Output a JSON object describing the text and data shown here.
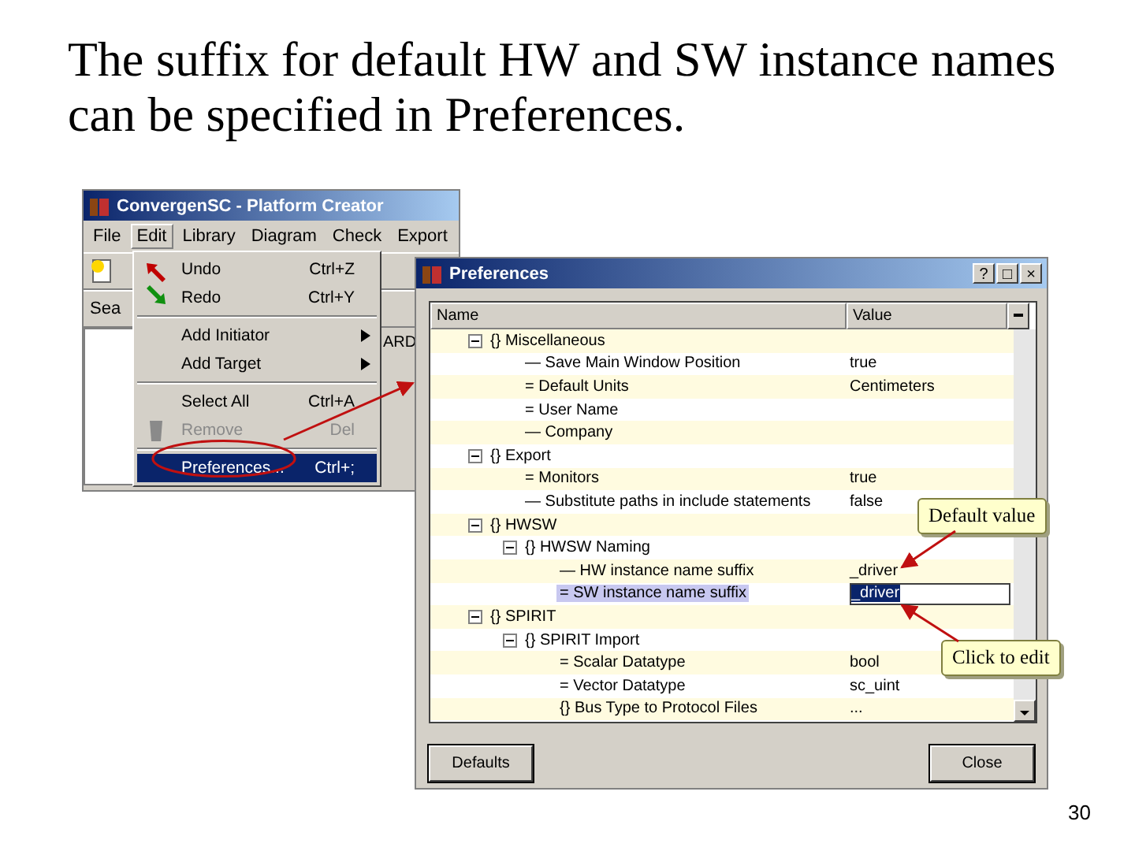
{
  "slide": {
    "title": "The suffix for default HW and SW instance names can be specified in Preferences.",
    "page_number": "30"
  },
  "main_window": {
    "title": "ConvergenSC - Platform Creator",
    "menus": [
      {
        "label": "File",
        "selected": false
      },
      {
        "label": "Edit",
        "selected": true
      },
      {
        "label": "Library",
        "selected": false
      },
      {
        "label": "Diagram",
        "selected": false
      },
      {
        "label": "Check",
        "selected": false
      },
      {
        "label": "Export",
        "selected": false
      }
    ],
    "search_label": "Sea",
    "tab_fragment": "ARD",
    "edit_menu": [
      {
        "kind": "item",
        "label": "Undo",
        "shortcut": "Ctrl+Z",
        "disabled": false,
        "selected": false
      },
      {
        "kind": "item",
        "label": "Redo",
        "shortcut": "Ctrl+Y",
        "disabled": false,
        "selected": false
      },
      {
        "kind": "separator"
      },
      {
        "kind": "submenu",
        "label": "Add Initiator",
        "disabled": false,
        "selected": false
      },
      {
        "kind": "submenu",
        "label": "Add Target",
        "disabled": false,
        "selected": false
      },
      {
        "kind": "separator"
      },
      {
        "kind": "item",
        "label": "Select All",
        "shortcut": "Ctrl+A",
        "disabled": false,
        "selected": false
      },
      {
        "kind": "item",
        "label": "Remove",
        "shortcut": "Del",
        "disabled": true,
        "selected": false
      },
      {
        "kind": "separator"
      },
      {
        "kind": "item",
        "label": "Preferences...",
        "shortcut": "Ctrl+;",
        "disabled": false,
        "selected": true
      }
    ]
  },
  "preferences": {
    "title": "Preferences",
    "title_buttons": [
      "?",
      "□",
      "×"
    ],
    "columns": [
      "Name",
      "Value"
    ],
    "tree": [
      {
        "kind": "group",
        "marker": "{}",
        "name": "Miscellaneous",
        "expanded": true,
        "children": [
          {
            "kind": "setting",
            "marker": "—",
            "name": "Save Main Window Position",
            "value": "true",
            "selected": false
          },
          {
            "kind": "setting",
            "marker": "=",
            "name": "Default Units",
            "value": "Centimeters",
            "selected": false
          },
          {
            "kind": "setting",
            "marker": "=",
            "name": "User Name",
            "selected": false
          },
          {
            "kind": "setting",
            "marker": "—",
            "name": "Company",
            "selected": false
          }
        ]
      },
      {
        "kind": "group",
        "marker": "{}",
        "name": "Export",
        "expanded": true,
        "children": [
          {
            "kind": "setting",
            "marker": "=",
            "name": "Monitors",
            "value": "true",
            "selected": false
          },
          {
            "kind": "setting",
            "marker": "—",
            "name": "Substitute paths in include statements",
            "value": "false",
            "selected": false
          }
        ]
      },
      {
        "kind": "group",
        "marker": "{}",
        "name": "HWSW",
        "expanded": true,
        "children": [
          {
            "kind": "group",
            "marker": "{}",
            "name": "HWSW Naming",
            "expanded": true,
            "children": [
              {
                "kind": "setting",
                "marker": "—",
                "name": "HW instance name suffix",
                "value": "_driver",
                "selected": false
              },
              {
                "kind": "setting",
                "marker": "=",
                "name": "SW instance name suffix",
                "value": "_driver",
                "selected": true
              }
            ]
          }
        ]
      },
      {
        "kind": "group",
        "marker": "{}",
        "name": "SPIRIT",
        "expanded": true,
        "children": [
          {
            "kind": "group",
            "marker": "{}",
            "name": "SPIRIT Import",
            "expanded": true,
            "children": [
              {
                "kind": "setting",
                "marker": "=",
                "name": "Scalar Datatype",
                "value": "bool",
                "selected": false
              },
              {
                "kind": "setting",
                "marker": "=",
                "name": "Vector Datatype",
                "value": "sc_uint",
                "selected": false
              },
              {
                "kind": "setting",
                "marker": "{}",
                "name": "Bus Type to Protocol Files",
                "value": "...",
                "selected": false
              }
            ]
          }
        ]
      }
    ],
    "buttons": [
      "Defaults",
      "Close"
    ]
  },
  "callouts": [
    {
      "kind": "default",
      "text": "Default value"
    },
    {
      "kind": "edit",
      "text": "Click to edit"
    }
  ]
}
